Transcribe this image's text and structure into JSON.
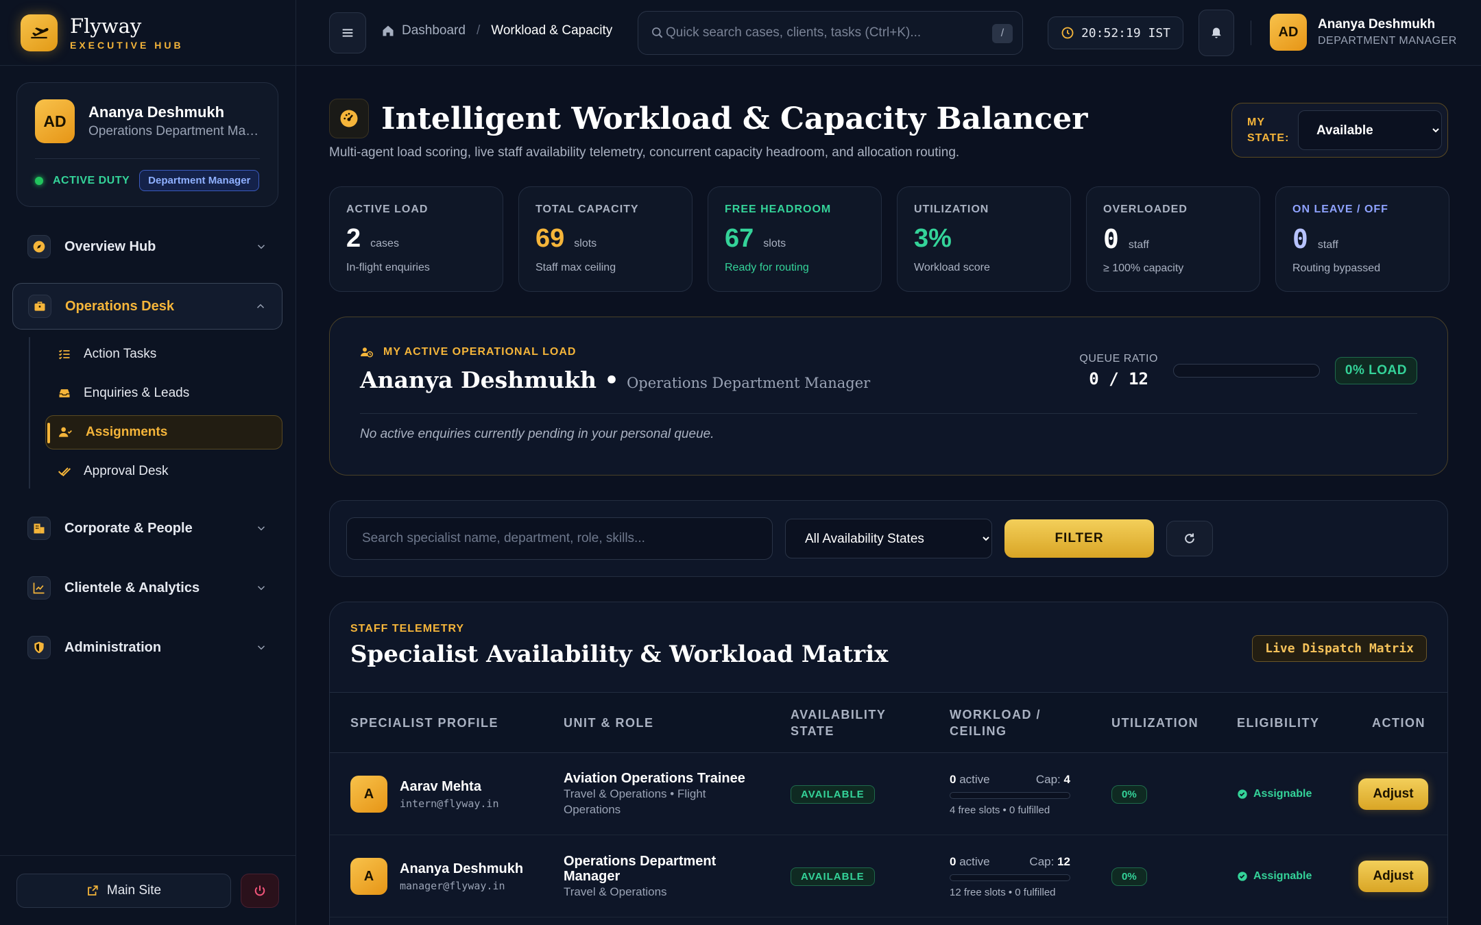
{
  "brand": {
    "name": "Flyway",
    "sub": "EXECUTIVE HUB"
  },
  "profile": {
    "initials": "AD",
    "name": "Ananya Deshmukh",
    "role": "Operations Department Manager",
    "status": "ACTIVE DUTY",
    "badge": "Department Manager"
  },
  "nav": {
    "overview": "Overview Hub",
    "operations": "Operations Desk",
    "sub": {
      "action_tasks": "Action Tasks",
      "enquiries": "Enquiries & Leads",
      "assignments": "Assignments",
      "approval": "Approval Desk"
    },
    "corporate": "Corporate & People",
    "clientele": "Clientele & Analytics",
    "admin": "Administration"
  },
  "footer": {
    "main_site": "Main Site"
  },
  "topbar": {
    "crumb_home": "Dashboard",
    "crumb_sep": "/",
    "crumb_current": "Workload & Capacity",
    "search_placeholder": "Quick search cases, clients, tasks (Ctrl+K)...",
    "search_key": "/",
    "clock": "20:52:19 IST",
    "user_initials": "AD",
    "user_name": "Ananya Deshmukh",
    "user_role": "DEPARTMENT MANAGER"
  },
  "page": {
    "title": "Intelligent Workload & Capacity Balancer",
    "subtitle": "Multi-agent load scoring, live staff availability telemetry, concurrent capacity headroom, and allocation routing.",
    "my_state_label": "MY STATE:",
    "my_state_value": "Available"
  },
  "kpis": {
    "active": {
      "label": "ACTIVE LOAD",
      "value": "2",
      "unit": "cases",
      "foot": "In-flight enquiries"
    },
    "capacity": {
      "label": "TOTAL CAPACITY",
      "value": "69",
      "unit": "slots",
      "foot": "Staff max ceiling"
    },
    "headroom": {
      "label": "FREE HEADROOM",
      "value": "67",
      "unit": "slots",
      "foot": "Ready for routing"
    },
    "util": {
      "label": "UTILIZATION",
      "value": "3%",
      "unit": "",
      "foot": "Workload score"
    },
    "overloaded": {
      "label": "OVERLOADED",
      "value": "0",
      "unit": "staff",
      "foot": "≥ 100% capacity"
    },
    "leave": {
      "label": "ON LEAVE / OFF",
      "value": "0",
      "unit": "staff",
      "foot": "Routing bypassed"
    }
  },
  "my_load": {
    "label": "MY ACTIVE OPERATIONAL LOAD",
    "name": "Ananya Deshmukh",
    "bullet": "•",
    "role": "Operations Department Manager",
    "queue_label": "QUEUE RATIO",
    "queue_value": "0 / 12",
    "queue_fraction": 0,
    "load_pill": "0% LOAD",
    "empty": "No active enquiries currently pending in your personal queue."
  },
  "filters": {
    "search_placeholder": "Search specialist name, department, role, skills...",
    "state_value": "All Availability States",
    "filter_label": "FILTER"
  },
  "matrix": {
    "kicker": "STAFF TELEMETRY",
    "title": "Specialist Availability & Workload Matrix",
    "tag": "Live Dispatch Matrix",
    "headers": {
      "profile": "SPECIALIST PROFILE",
      "unit": "UNIT & ROLE",
      "state_1": "AVAILABILITY",
      "state_2": "STATE",
      "workload_1": "WORKLOAD /",
      "workload_2": "CEILING",
      "util": "UTILIZATION",
      "elig": "ELIGIBILITY",
      "action": "ACTION"
    },
    "rows": [
      {
        "initial": "A",
        "name": "Aarav Mehta",
        "email": "intern@flyway.in",
        "role": "Aviation Operations Trainee",
        "dept_1": "Travel & Operations • Flight",
        "dept_2": "Operations",
        "state": "AVAILABLE",
        "active": "0",
        "active_label": "active",
        "cap_label": "Cap:",
        "cap": "4",
        "fill": 0,
        "foot": "4 free slots • 0 fulfilled",
        "util": "0%",
        "elig": "Assignable",
        "action": "Adjust"
      },
      {
        "initial": "A",
        "name": "Ananya Deshmukh",
        "email": "manager@flyway.in",
        "role_1": "Operations Department",
        "role_2": "Manager",
        "dept_1": "Travel & Operations",
        "state": "AVAILABLE",
        "active": "0",
        "active_label": "active",
        "cap_label": "Cap:",
        "cap": "12",
        "fill": 0,
        "foot": "12 free slots • 0 fulfilled",
        "util": "0%",
        "elig": "Assignable",
        "action": "Adjust"
      }
    ]
  }
}
